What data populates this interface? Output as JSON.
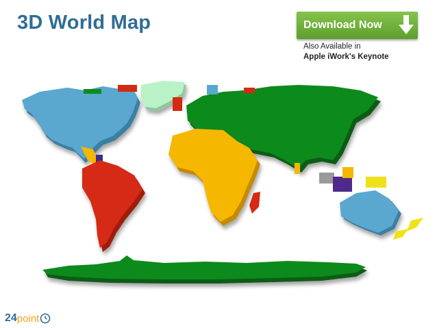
{
  "header": {
    "title": "3D World Map"
  },
  "download": {
    "label": "Download Now",
    "icon": "arrow-down-icon",
    "color": "#6fb23a"
  },
  "availability": {
    "line1": "Also Available in",
    "line2": "Apple iWork's Keynote"
  },
  "continents": [
    {
      "name": "North America",
      "color": "#5aa8cf"
    },
    {
      "name": "South America",
      "color": "#d42a12"
    },
    {
      "name": "Europe and Asia",
      "color": "#0f7a1a"
    },
    {
      "name": "Africa",
      "color": "#f5b700"
    },
    {
      "name": "Australia",
      "color": "#5aa8cf"
    },
    {
      "name": "Antarctica",
      "color": "#0f7a1a"
    },
    {
      "name": "Greenland",
      "color": "#b9f2c6"
    }
  ],
  "logo": {
    "number": "24",
    "word": "point",
    "icon": "clock-icon"
  }
}
